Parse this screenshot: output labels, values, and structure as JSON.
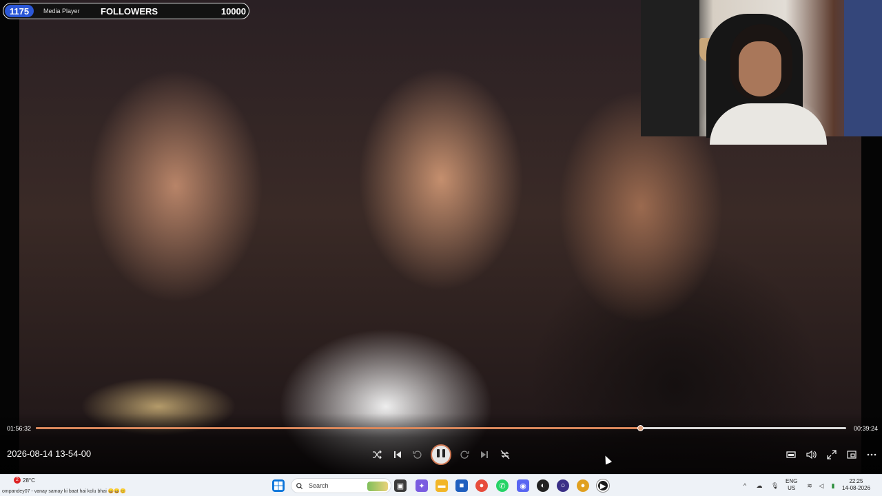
{
  "overlay": {
    "follower_count": "1175",
    "window_title": "Media Player",
    "followers_label": "FOLLOWERS",
    "follower_goal": "10000"
  },
  "player": {
    "elapsed": "01:56:32",
    "remaining": "00:39:24",
    "progress_fraction": 0.746,
    "video_title": "2026-08-14 13-54-00",
    "controls": {
      "shuffle": "shuffle-icon",
      "previous": "previous-icon",
      "rewind": "rewind-10-icon",
      "play_pause": "pause-icon",
      "forward": "forward-30-icon",
      "next": "next-icon",
      "repeat": "repeat-off-icon",
      "captions": "miniplayer-icon",
      "volume": "volume-icon",
      "fullscreen": "fullscreen-icon",
      "cast": "cast-icon",
      "more": "more-icon"
    },
    "accent_color": "#d9875b"
  },
  "taskbar": {
    "notification_count": "2",
    "temperature": "28°C",
    "ticker": "ompandey07 - vanay samay ki baat hai kolu bhai 😄😄😊",
    "search_placeholder": "Search",
    "language": "ENG",
    "region": "US",
    "time": "22:25",
    "date": "14-08-2026"
  }
}
